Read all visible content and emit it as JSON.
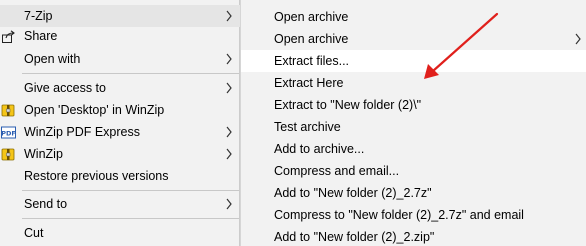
{
  "main_menu": {
    "items": [
      {
        "label": "7-Zip",
        "icon": "none",
        "has_submenu": true
      },
      {
        "label": "Share",
        "icon": "share-icon",
        "has_submenu": false
      },
      {
        "label": "Open with",
        "icon": "none",
        "has_submenu": true
      },
      {
        "label": "Give access to",
        "icon": "none",
        "has_submenu": true
      },
      {
        "label": "Open 'Desktop' in WinZip",
        "icon": "winzip-icon",
        "has_submenu": false
      },
      {
        "label": "WinZip PDF Express",
        "icon": "pdf-icon",
        "has_submenu": true
      },
      {
        "label": "WinZip",
        "icon": "winzip-icon",
        "has_submenu": true
      },
      {
        "label": "Restore previous versions",
        "icon": "none",
        "has_submenu": false
      },
      {
        "label": "Send to",
        "icon": "none",
        "has_submenu": true
      },
      {
        "label": "Cut",
        "icon": "none",
        "has_submenu": false
      }
    ],
    "pdf_icon_text": "PDF"
  },
  "submenu": {
    "items": [
      {
        "label": "Open archive",
        "has_submenu": false
      },
      {
        "label": "Open archive",
        "has_submenu": true
      },
      {
        "label": "Extract files...",
        "has_submenu": false,
        "highlighted": true
      },
      {
        "label": "Extract Here",
        "has_submenu": false
      },
      {
        "label": "Extract to \"New folder (2)\\\"",
        "has_submenu": false
      },
      {
        "label": "Test archive",
        "has_submenu": false
      },
      {
        "label": "Add to archive...",
        "has_submenu": false
      },
      {
        "label": "Compress and email...",
        "has_submenu": false
      },
      {
        "label": "Add to \"New folder (2)_2.7z\"",
        "has_submenu": false
      },
      {
        "label": "Compress to \"New folder (2)_2.7z\" and email",
        "has_submenu": false
      },
      {
        "label": "Add to \"New folder (2)_2.zip\"",
        "has_submenu": false
      }
    ]
  },
  "colors": {
    "menu_bg": "#f2f2f2",
    "highlight_main": "#e5e5e5",
    "highlight_sub": "#ffffff",
    "annotation_arrow": "#e0201c",
    "winzip_yellow": "#f5c518",
    "pdf_blue": "#2a5db0"
  }
}
